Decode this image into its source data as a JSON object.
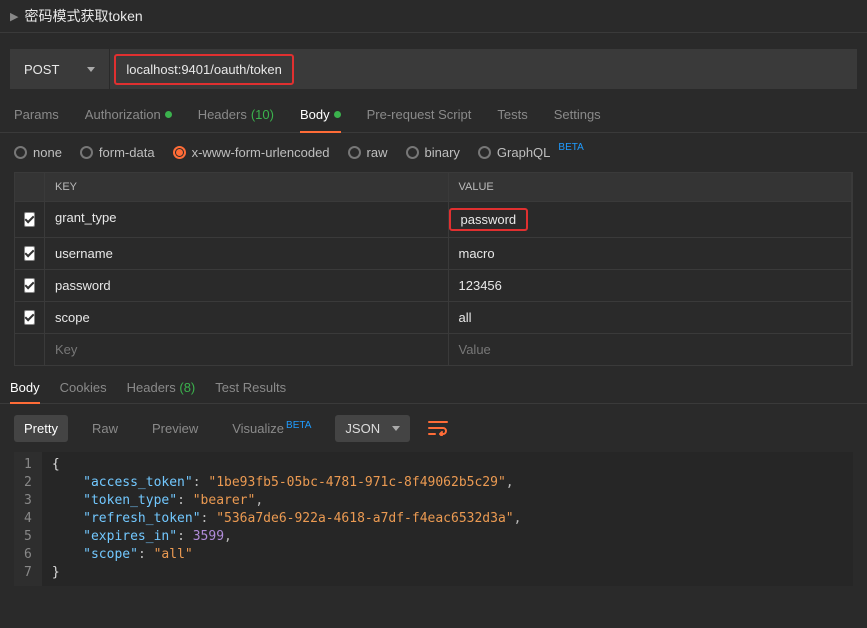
{
  "header": {
    "title": "密码模式获取token"
  },
  "request": {
    "method": "POST",
    "url": "localhost:9401/oauth/token"
  },
  "subtabs": {
    "params": "Params",
    "auth": "Authorization",
    "headers": "Headers",
    "headers_count": "(10)",
    "body": "Body",
    "prerequest": "Pre-request Script",
    "tests": "Tests",
    "settings": "Settings"
  },
  "bodyTypes": {
    "none": "none",
    "formdata": "form-data",
    "urlencoded": "x-www-form-urlencoded",
    "raw": "raw",
    "binary": "binary",
    "graphql": "GraphQL",
    "beta": "BETA"
  },
  "kv": {
    "head_key": "KEY",
    "head_value": "VALUE",
    "rows": [
      {
        "key": "grant_type",
        "value": "password"
      },
      {
        "key": "username",
        "value": "macro"
      },
      {
        "key": "password",
        "value": "123456"
      },
      {
        "key": "scope",
        "value": "all"
      }
    ],
    "placeholder_key": "Key",
    "placeholder_value": "Value"
  },
  "response": {
    "tabs": {
      "body": "Body",
      "cookies": "Cookies",
      "headers": "Headers",
      "headers_count": "(8)",
      "testresults": "Test Results"
    },
    "tools": {
      "pretty": "Pretty",
      "raw": "Raw",
      "preview": "Preview",
      "visualize": "Visualize",
      "beta": "BETA",
      "json": "JSON"
    }
  },
  "json_response": {
    "access_token": "1be93fb5-05bc-4781-971c-8f49062b5c29",
    "token_type": "bearer",
    "refresh_token": "536a7de6-922a-4618-a7df-f4eac6532d3a",
    "expires_in": 3599,
    "scope": "all"
  }
}
